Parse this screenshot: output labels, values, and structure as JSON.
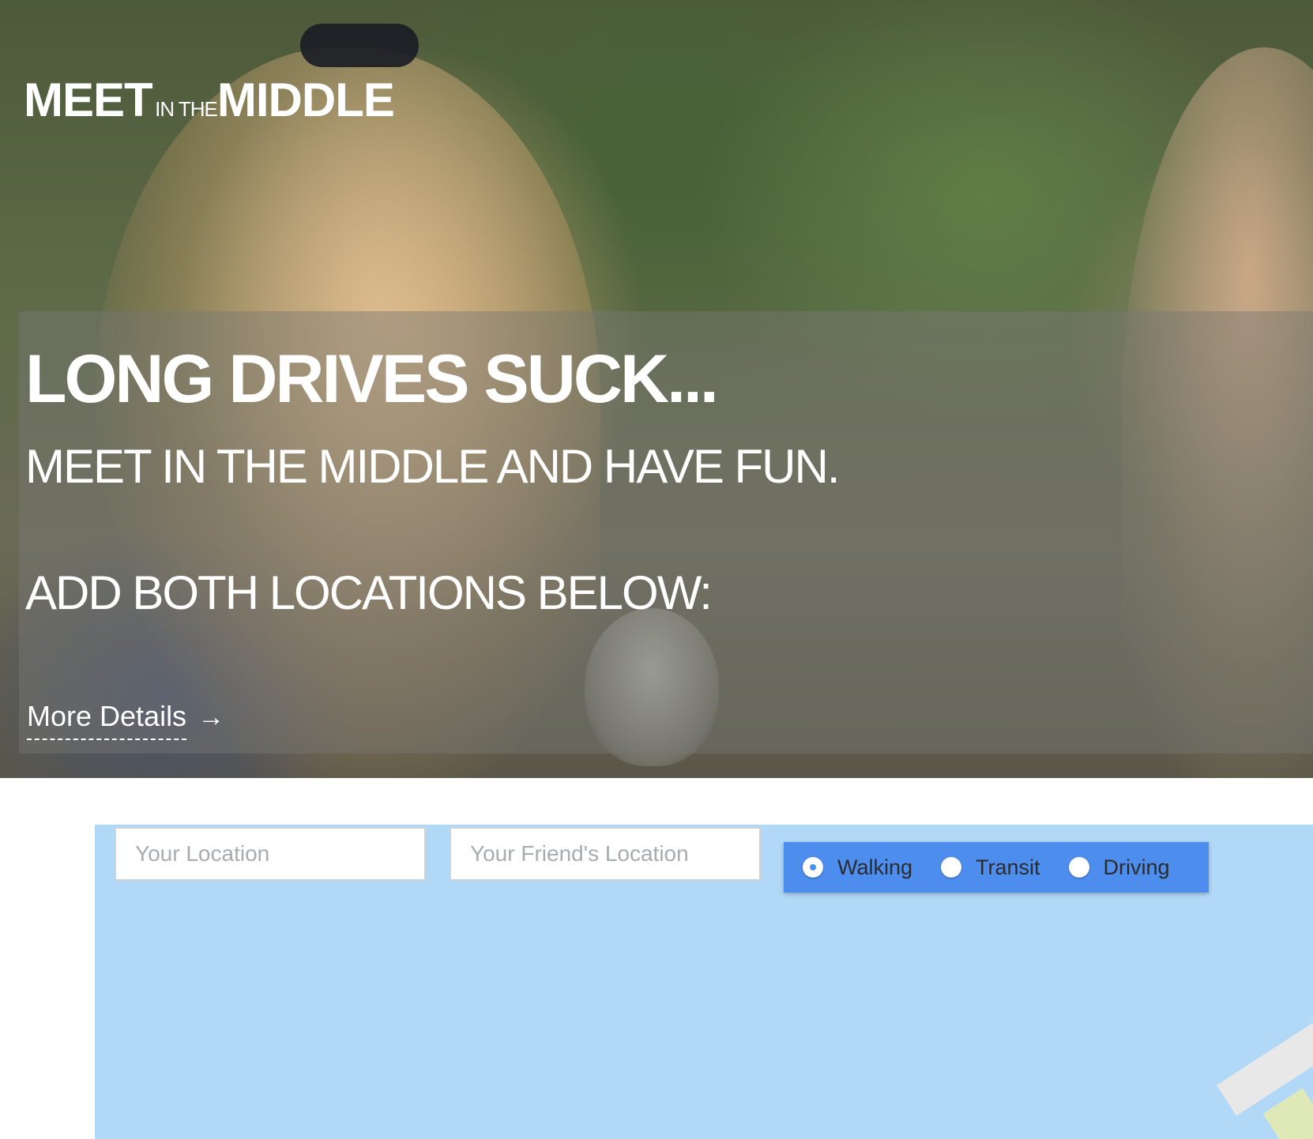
{
  "logo": {
    "meet": "MEET",
    "in_the": "IN THE",
    "middle": "MIDDLE"
  },
  "hero": {
    "headline": "LONG DRIVES SUCK...",
    "subheadline": "MEET IN THE MIDDLE AND HAVE FUN.",
    "prompt": "ADD BOTH LOCATIONS BELOW:",
    "more_details_label": "More Details",
    "more_details_arrow": "→"
  },
  "form": {
    "your_location_placeholder": "Your Location",
    "friend_location_placeholder": "Your Friend's Location",
    "travel_modes": [
      {
        "label": "Walking",
        "selected": true
      },
      {
        "label": "Transit",
        "selected": false
      },
      {
        "label": "Driving",
        "selected": false
      }
    ]
  },
  "colors": {
    "map_water": "#b2d8f7",
    "mode_box": "#4d8ded",
    "text_on_hero": "#ffffff"
  }
}
